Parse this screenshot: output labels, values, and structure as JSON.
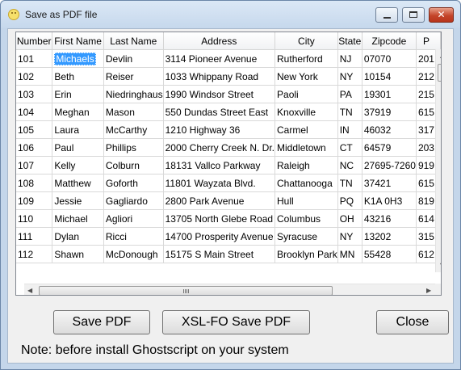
{
  "window": {
    "title": "Save as PDF file",
    "minimize_symbol": "",
    "close_symbol": "✕"
  },
  "table": {
    "columns": [
      "Number",
      "First Name",
      "Last Name",
      "Address",
      "City",
      "State",
      "Zipcode",
      "P"
    ],
    "rows": [
      [
        "101",
        "Michaels",
        "Devlin",
        "3114 Pioneer Avenue",
        "Rutherford",
        "NJ",
        "07070",
        "201"
      ],
      [
        "102",
        "Beth",
        "Reiser",
        "1033 Whippany Road",
        "New York",
        "NY",
        "10154",
        "212"
      ],
      [
        "103",
        "Erin",
        "Niedringhaus",
        "1990 Windsor Street",
        "Paoli",
        "PA",
        "19301",
        "215"
      ],
      [
        "104",
        "Meghan",
        "Mason",
        "550 Dundas Street East",
        "Knoxville",
        "TN",
        "37919",
        "615"
      ],
      [
        "105",
        "Laura",
        "McCarthy",
        "1210 Highway 36",
        "Carmel",
        "IN",
        "46032",
        "317"
      ],
      [
        "106",
        "Paul",
        "Phillips",
        "2000 Cherry Creek N. Dr.",
        "Middletown",
        "CT",
        "64579",
        "203"
      ],
      [
        "107",
        "Kelly",
        "Colburn",
        "18131 Vallco Parkway",
        "Raleigh",
        "NC",
        "27695-7260",
        "919"
      ],
      [
        "108",
        "Matthew",
        "Goforth",
        "11801 Wayzata Blvd.",
        "Chattanooga",
        "TN",
        "37421",
        "615"
      ],
      [
        "109",
        "Jessie",
        "Gagliardo",
        "2800 Park Avenue",
        "Hull",
        "PQ",
        "K1A 0H3",
        "819"
      ],
      [
        "110",
        "Michael",
        "Agliori",
        "13705 North Glebe Road",
        "Columbus",
        "OH",
        "43216",
        "614"
      ],
      [
        "111",
        "Dylan",
        "Ricci",
        "14700 Prosperity Avenue",
        "Syracuse",
        "NY",
        "13202",
        "315"
      ],
      [
        "112",
        "Shawn",
        "McDonough",
        "15175 S Main Street",
        "Brooklyn Park",
        "MN",
        "55428",
        "612"
      ]
    ]
  },
  "scrollbar": {
    "up_arrow": "▲",
    "down_arrow": "▼",
    "left_arrow": "◀",
    "right_arrow": "▶"
  },
  "buttons": {
    "save_pdf": "Save PDF",
    "xslfo_save_pdf": "XSL-FO Save PDF",
    "close": "Close"
  },
  "note": "Note: before install Ghostscript on your system",
  "colors": {
    "selection": "#3399ff",
    "window_frame": "#c4d6ea",
    "close_button": "#c4452a"
  }
}
